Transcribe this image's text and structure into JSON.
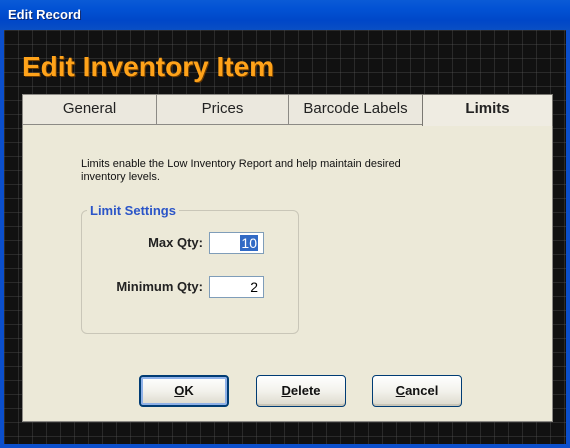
{
  "window": {
    "title": "Edit Record"
  },
  "header": {
    "title": "Edit Inventory Item"
  },
  "tabs": [
    {
      "label": "General",
      "active": false
    },
    {
      "label": "Prices",
      "active": false
    },
    {
      "label": "Barcode Labels",
      "active": false
    },
    {
      "label": "Limits",
      "active": true
    }
  ],
  "limits": {
    "description": "Limits enable the Low Inventory Report and help maintain desired inventory levels.",
    "group_title": "Limit Settings",
    "max_qty": {
      "label": "Max Qty:",
      "value": "10"
    },
    "min_qty": {
      "label": "Minimum Qty:",
      "value": "2"
    }
  },
  "buttons": {
    "ok": {
      "mnemonic": "O",
      "rest": "K"
    },
    "delete": {
      "mnemonic": "D",
      "rest": "elete"
    },
    "cancel": {
      "mnemonic": "C",
      "rest": "ancel"
    }
  },
  "colors": {
    "titlebar": "#0252d4",
    "header_title": "#ffa31a",
    "group_title": "#2b55c8",
    "selection": "#316ac5"
  }
}
